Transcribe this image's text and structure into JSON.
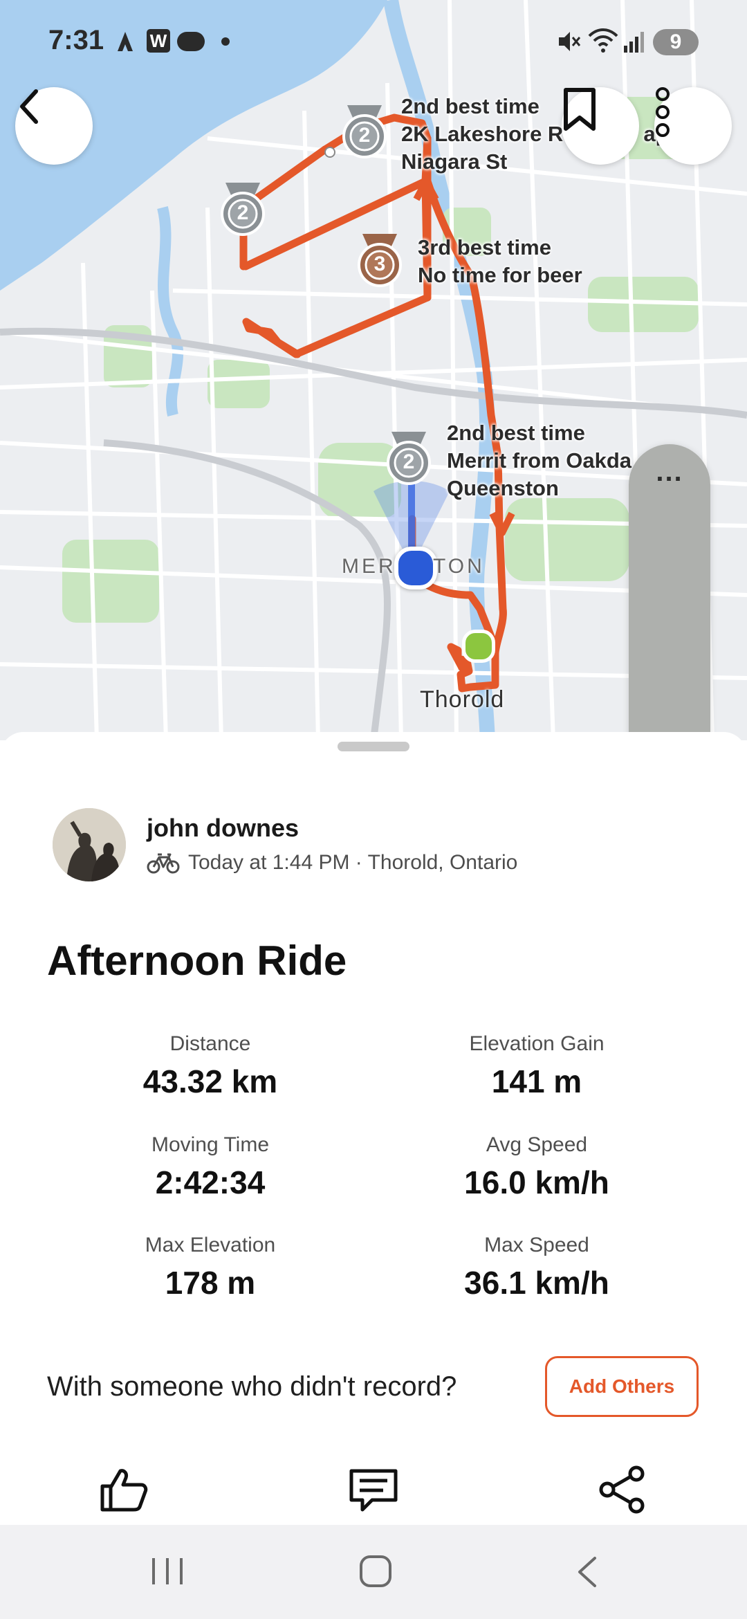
{
  "status_bar": {
    "time": "7:31",
    "left_icons": [
      "strava-arrow-icon",
      "w-app-icon",
      "pluto-tv-icon",
      "notification-dot-icon"
    ],
    "w_badge": "W",
    "battery": "9",
    "right_icons": [
      "mute-icon",
      "wifi-icon",
      "signal-icon",
      "battery-icon"
    ]
  },
  "map": {
    "segments": [
      {
        "line1": "2nd best time",
        "line2": "2K Lakeshore R",
        "line2_tail": "ap",
        "line3": "Niagara St",
        "medal": "2"
      },
      {
        "line1": "3rd best time",
        "line2": "No time for beer",
        "medal": "3"
      },
      {
        "line1": "2nd best time",
        "line2": "Merrit from Oakda",
        "line3": "Queenston",
        "medal": "2"
      }
    ],
    "extra_medal": "2",
    "place_labels": {
      "merriton_left": "MER",
      "merriton_right": "TON",
      "thorold": "Thorold"
    },
    "colors": {
      "route": "#e4582a",
      "start_dot": "#8cc63f",
      "location_dot": "#2a5bd7",
      "water": "#a9cff0",
      "park": "#c9e6c0"
    }
  },
  "volume_panel": {
    "more_icon": "...",
    "mute_icon": "mute-vibrate-icon"
  },
  "activity": {
    "athlete_name": "john downes",
    "sport_icon": "bike-icon",
    "meta": "Today at 1:44 PM · Thorold, Ontario",
    "title": "Afternoon Ride",
    "stats": [
      {
        "label": "Distance",
        "value": "43.32 km"
      },
      {
        "label": "Elevation Gain",
        "value": "141 m"
      },
      {
        "label": "Moving Time",
        "value": "2:42:34"
      },
      {
        "label": "Avg Speed",
        "value": "16.0 km/h"
      },
      {
        "label": "Max Elevation",
        "value": "178 m"
      },
      {
        "label": "Max Speed",
        "value": "36.1 km/h"
      }
    ],
    "prompt": "With someone who didn't record?",
    "add_others_label": "Add Others"
  },
  "actions": [
    "thumbs-up-icon",
    "comment-icon",
    "share-icon"
  ],
  "nav_bar": [
    "recent-apps-icon",
    "home-icon",
    "back-icon"
  ]
}
